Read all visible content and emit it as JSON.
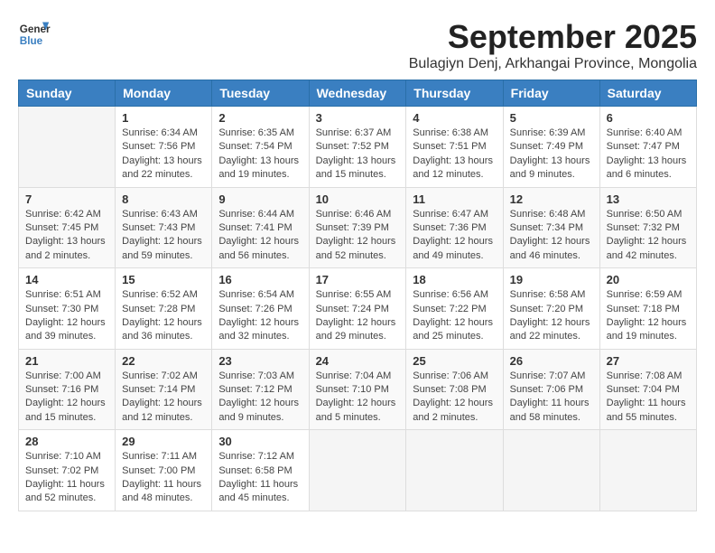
{
  "header": {
    "logo_general": "General",
    "logo_blue": "Blue",
    "month_title": "September 2025",
    "location": "Bulagiyn Denj, Arkhangai Province, Mongolia"
  },
  "weekdays": [
    "Sunday",
    "Monday",
    "Tuesday",
    "Wednesday",
    "Thursday",
    "Friday",
    "Saturday"
  ],
  "weeks": [
    [
      {
        "day": "",
        "info": ""
      },
      {
        "day": "1",
        "info": "Sunrise: 6:34 AM\nSunset: 7:56 PM\nDaylight: 13 hours\nand 22 minutes."
      },
      {
        "day": "2",
        "info": "Sunrise: 6:35 AM\nSunset: 7:54 PM\nDaylight: 13 hours\nand 19 minutes."
      },
      {
        "day": "3",
        "info": "Sunrise: 6:37 AM\nSunset: 7:52 PM\nDaylight: 13 hours\nand 15 minutes."
      },
      {
        "day": "4",
        "info": "Sunrise: 6:38 AM\nSunset: 7:51 PM\nDaylight: 13 hours\nand 12 minutes."
      },
      {
        "day": "5",
        "info": "Sunrise: 6:39 AM\nSunset: 7:49 PM\nDaylight: 13 hours\nand 9 minutes."
      },
      {
        "day": "6",
        "info": "Sunrise: 6:40 AM\nSunset: 7:47 PM\nDaylight: 13 hours\nand 6 minutes."
      }
    ],
    [
      {
        "day": "7",
        "info": "Sunrise: 6:42 AM\nSunset: 7:45 PM\nDaylight: 13 hours\nand 2 minutes."
      },
      {
        "day": "8",
        "info": "Sunrise: 6:43 AM\nSunset: 7:43 PM\nDaylight: 12 hours\nand 59 minutes."
      },
      {
        "day": "9",
        "info": "Sunrise: 6:44 AM\nSunset: 7:41 PM\nDaylight: 12 hours\nand 56 minutes."
      },
      {
        "day": "10",
        "info": "Sunrise: 6:46 AM\nSunset: 7:39 PM\nDaylight: 12 hours\nand 52 minutes."
      },
      {
        "day": "11",
        "info": "Sunrise: 6:47 AM\nSunset: 7:36 PM\nDaylight: 12 hours\nand 49 minutes."
      },
      {
        "day": "12",
        "info": "Sunrise: 6:48 AM\nSunset: 7:34 PM\nDaylight: 12 hours\nand 46 minutes."
      },
      {
        "day": "13",
        "info": "Sunrise: 6:50 AM\nSunset: 7:32 PM\nDaylight: 12 hours\nand 42 minutes."
      }
    ],
    [
      {
        "day": "14",
        "info": "Sunrise: 6:51 AM\nSunset: 7:30 PM\nDaylight: 12 hours\nand 39 minutes."
      },
      {
        "day": "15",
        "info": "Sunrise: 6:52 AM\nSunset: 7:28 PM\nDaylight: 12 hours\nand 36 minutes."
      },
      {
        "day": "16",
        "info": "Sunrise: 6:54 AM\nSunset: 7:26 PM\nDaylight: 12 hours\nand 32 minutes."
      },
      {
        "day": "17",
        "info": "Sunrise: 6:55 AM\nSunset: 7:24 PM\nDaylight: 12 hours\nand 29 minutes."
      },
      {
        "day": "18",
        "info": "Sunrise: 6:56 AM\nSunset: 7:22 PM\nDaylight: 12 hours\nand 25 minutes."
      },
      {
        "day": "19",
        "info": "Sunrise: 6:58 AM\nSunset: 7:20 PM\nDaylight: 12 hours\nand 22 minutes."
      },
      {
        "day": "20",
        "info": "Sunrise: 6:59 AM\nSunset: 7:18 PM\nDaylight: 12 hours\nand 19 minutes."
      }
    ],
    [
      {
        "day": "21",
        "info": "Sunrise: 7:00 AM\nSunset: 7:16 PM\nDaylight: 12 hours\nand 15 minutes."
      },
      {
        "day": "22",
        "info": "Sunrise: 7:02 AM\nSunset: 7:14 PM\nDaylight: 12 hours\nand 12 minutes."
      },
      {
        "day": "23",
        "info": "Sunrise: 7:03 AM\nSunset: 7:12 PM\nDaylight: 12 hours\nand 9 minutes."
      },
      {
        "day": "24",
        "info": "Sunrise: 7:04 AM\nSunset: 7:10 PM\nDaylight: 12 hours\nand 5 minutes."
      },
      {
        "day": "25",
        "info": "Sunrise: 7:06 AM\nSunset: 7:08 PM\nDaylight: 12 hours\nand 2 minutes."
      },
      {
        "day": "26",
        "info": "Sunrise: 7:07 AM\nSunset: 7:06 PM\nDaylight: 11 hours\nand 58 minutes."
      },
      {
        "day": "27",
        "info": "Sunrise: 7:08 AM\nSunset: 7:04 PM\nDaylight: 11 hours\nand 55 minutes."
      }
    ],
    [
      {
        "day": "28",
        "info": "Sunrise: 7:10 AM\nSunset: 7:02 PM\nDaylight: 11 hours\nand 52 minutes."
      },
      {
        "day": "29",
        "info": "Sunrise: 7:11 AM\nSunset: 7:00 PM\nDaylight: 11 hours\nand 48 minutes."
      },
      {
        "day": "30",
        "info": "Sunrise: 7:12 AM\nSunset: 6:58 PM\nDaylight: 11 hours\nand 45 minutes."
      },
      {
        "day": "",
        "info": ""
      },
      {
        "day": "",
        "info": ""
      },
      {
        "day": "",
        "info": ""
      },
      {
        "day": "",
        "info": ""
      }
    ]
  ]
}
